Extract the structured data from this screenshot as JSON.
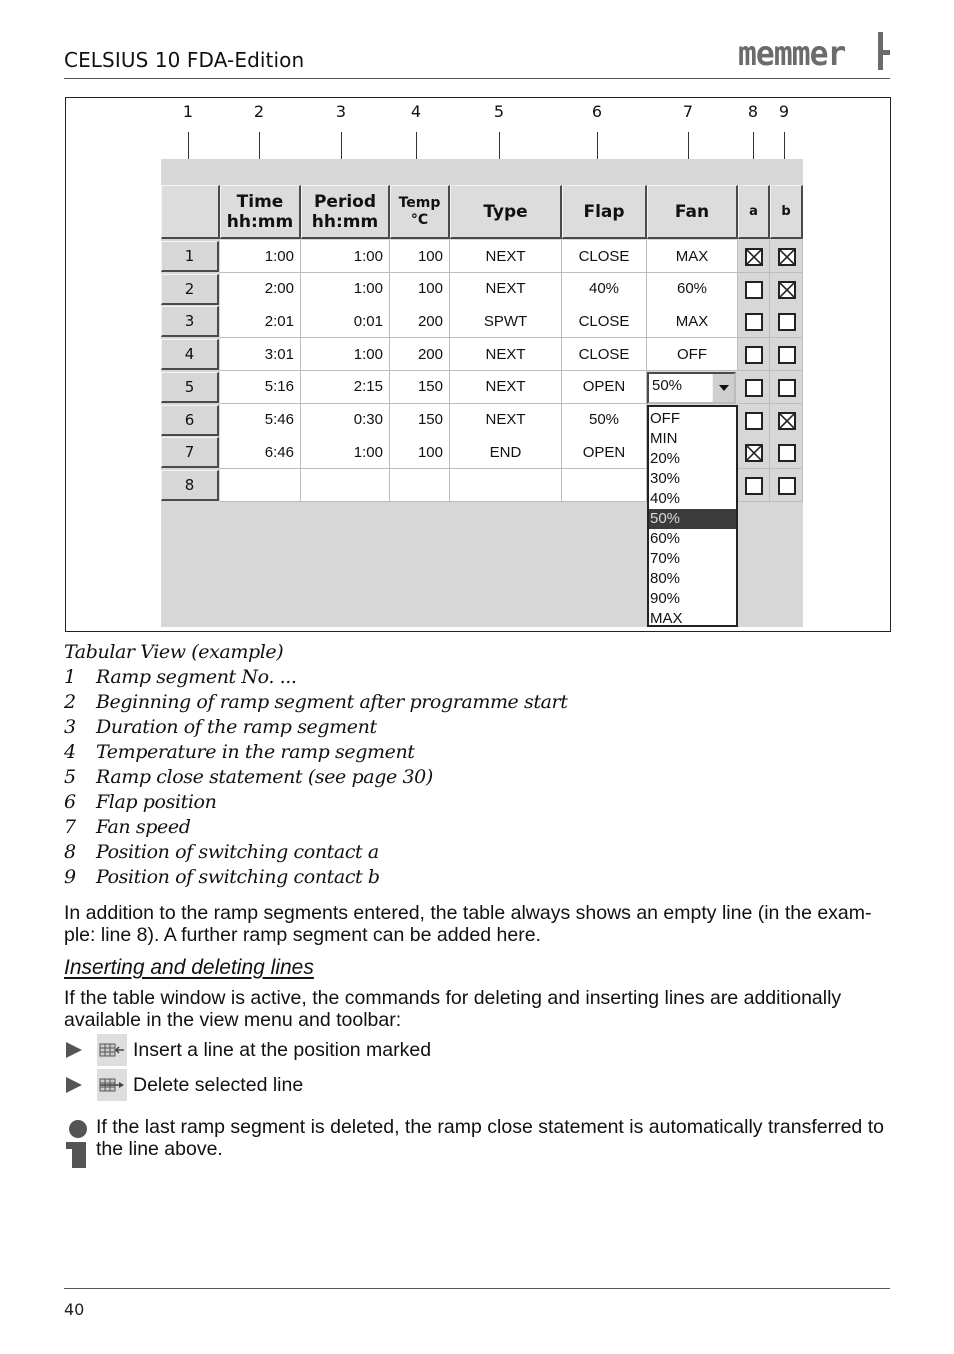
{
  "header": {
    "title": "CELSIUS 10 FDA-Edition",
    "logo_text": "memmer"
  },
  "figure": {
    "callouts": [
      "1",
      "2",
      "3",
      "4",
      "5",
      "6",
      "7",
      "8",
      "9"
    ],
    "columns": [
      {
        "label": "",
        "sub": ""
      },
      {
        "label": "Time",
        "sub": "hh:mm"
      },
      {
        "label": "Period",
        "sub": "hh:mm"
      },
      {
        "label": "Temp",
        "sub": "°C"
      },
      {
        "label": "Type",
        "sub": ""
      },
      {
        "label": "Flap",
        "sub": ""
      },
      {
        "label": "Fan",
        "sub": ""
      },
      {
        "label": "a",
        "sub": ""
      },
      {
        "label": "b",
        "sub": ""
      }
    ],
    "rows": [
      {
        "no": "1",
        "time": "1:00",
        "period": "1:00",
        "temp": "100",
        "type": "NEXT",
        "flap": "CLOSE",
        "fan": "MAX",
        "a": true,
        "b": true
      },
      {
        "no": "2",
        "time": "2:00",
        "period": "1:00",
        "temp": "100",
        "type": "NEXT",
        "flap": "40%",
        "fan": "60%",
        "a": false,
        "b": true
      },
      {
        "no": "3",
        "time": "2:01",
        "period": "0:01",
        "temp": "200",
        "type": "SPWT",
        "flap": "CLOSE",
        "fan": "MAX",
        "a": false,
        "b": false
      },
      {
        "no": "4",
        "time": "3:01",
        "period": "1:00",
        "temp": "200",
        "type": "NEXT",
        "flap": "CLOSE",
        "fan": "OFF",
        "a": false,
        "b": false
      },
      {
        "no": "5",
        "time": "5:16",
        "period": "2:15",
        "temp": "150",
        "type": "NEXT",
        "flap": "OPEN",
        "fan": "50%",
        "a": false,
        "b": false
      },
      {
        "no": "6",
        "time": "5:46",
        "period": "0:30",
        "temp": "150",
        "type": "NEXT",
        "flap": "50%",
        "fan": "",
        "a": false,
        "b": true
      },
      {
        "no": "7",
        "time": "6:46",
        "period": "1:00",
        "temp": "100",
        "type": "END",
        "flap": "OPEN",
        "fan": "",
        "a": true,
        "b": false
      },
      {
        "no": "8",
        "time": "",
        "period": "",
        "temp": "",
        "type": "",
        "flap": "",
        "fan": "",
        "a": false,
        "b": false
      }
    ],
    "fan_dropdown": {
      "selected": "50%",
      "options": [
        "OFF",
        "MIN",
        "20%",
        "30%",
        "40%",
        "50%",
        "60%",
        "70%",
        "80%",
        "90%",
        "MAX"
      ]
    }
  },
  "caption": "Tabular View (example)",
  "legend": [
    {
      "num": "1",
      "text": "Ramp segment No. ..."
    },
    {
      "num": "2",
      "text": "Beginning of ramp segment after programme start"
    },
    {
      "num": "3",
      "text": "Duration of the ramp segment"
    },
    {
      "num": "4",
      "text": "Temperature in the ramp segment"
    },
    {
      "num": "5",
      "text": "Ramp close statement (see page 30)"
    },
    {
      "num": "6",
      "text": "Flap position"
    },
    {
      "num": "7",
      "text": "Fan speed"
    },
    {
      "num": "8",
      "text": "Position of switching contact a"
    },
    {
      "num": "9",
      "text": "Position of switching contact b"
    }
  ],
  "paragraph1": "In addition to the ramp segments entered, the table always shows an empty line (in the exam-ple: line 8). A further ramp segment can be added here.",
  "subheading": "Inserting and deleting lines",
  "paragraph2": "If the table window is active, the commands for deleting and inserting lines are additionally available in the view menu and toolbar:",
  "bullets": [
    {
      "icon": "insert-line-icon",
      "label": "Insert a line at the position marked"
    },
    {
      "icon": "delete-line-icon",
      "label": "Delete selected line"
    }
  ],
  "note": "If the last ramp segment is deleted, the ramp close statement is automatically transferred to the line above.",
  "footer": {
    "page_number": "40"
  }
}
